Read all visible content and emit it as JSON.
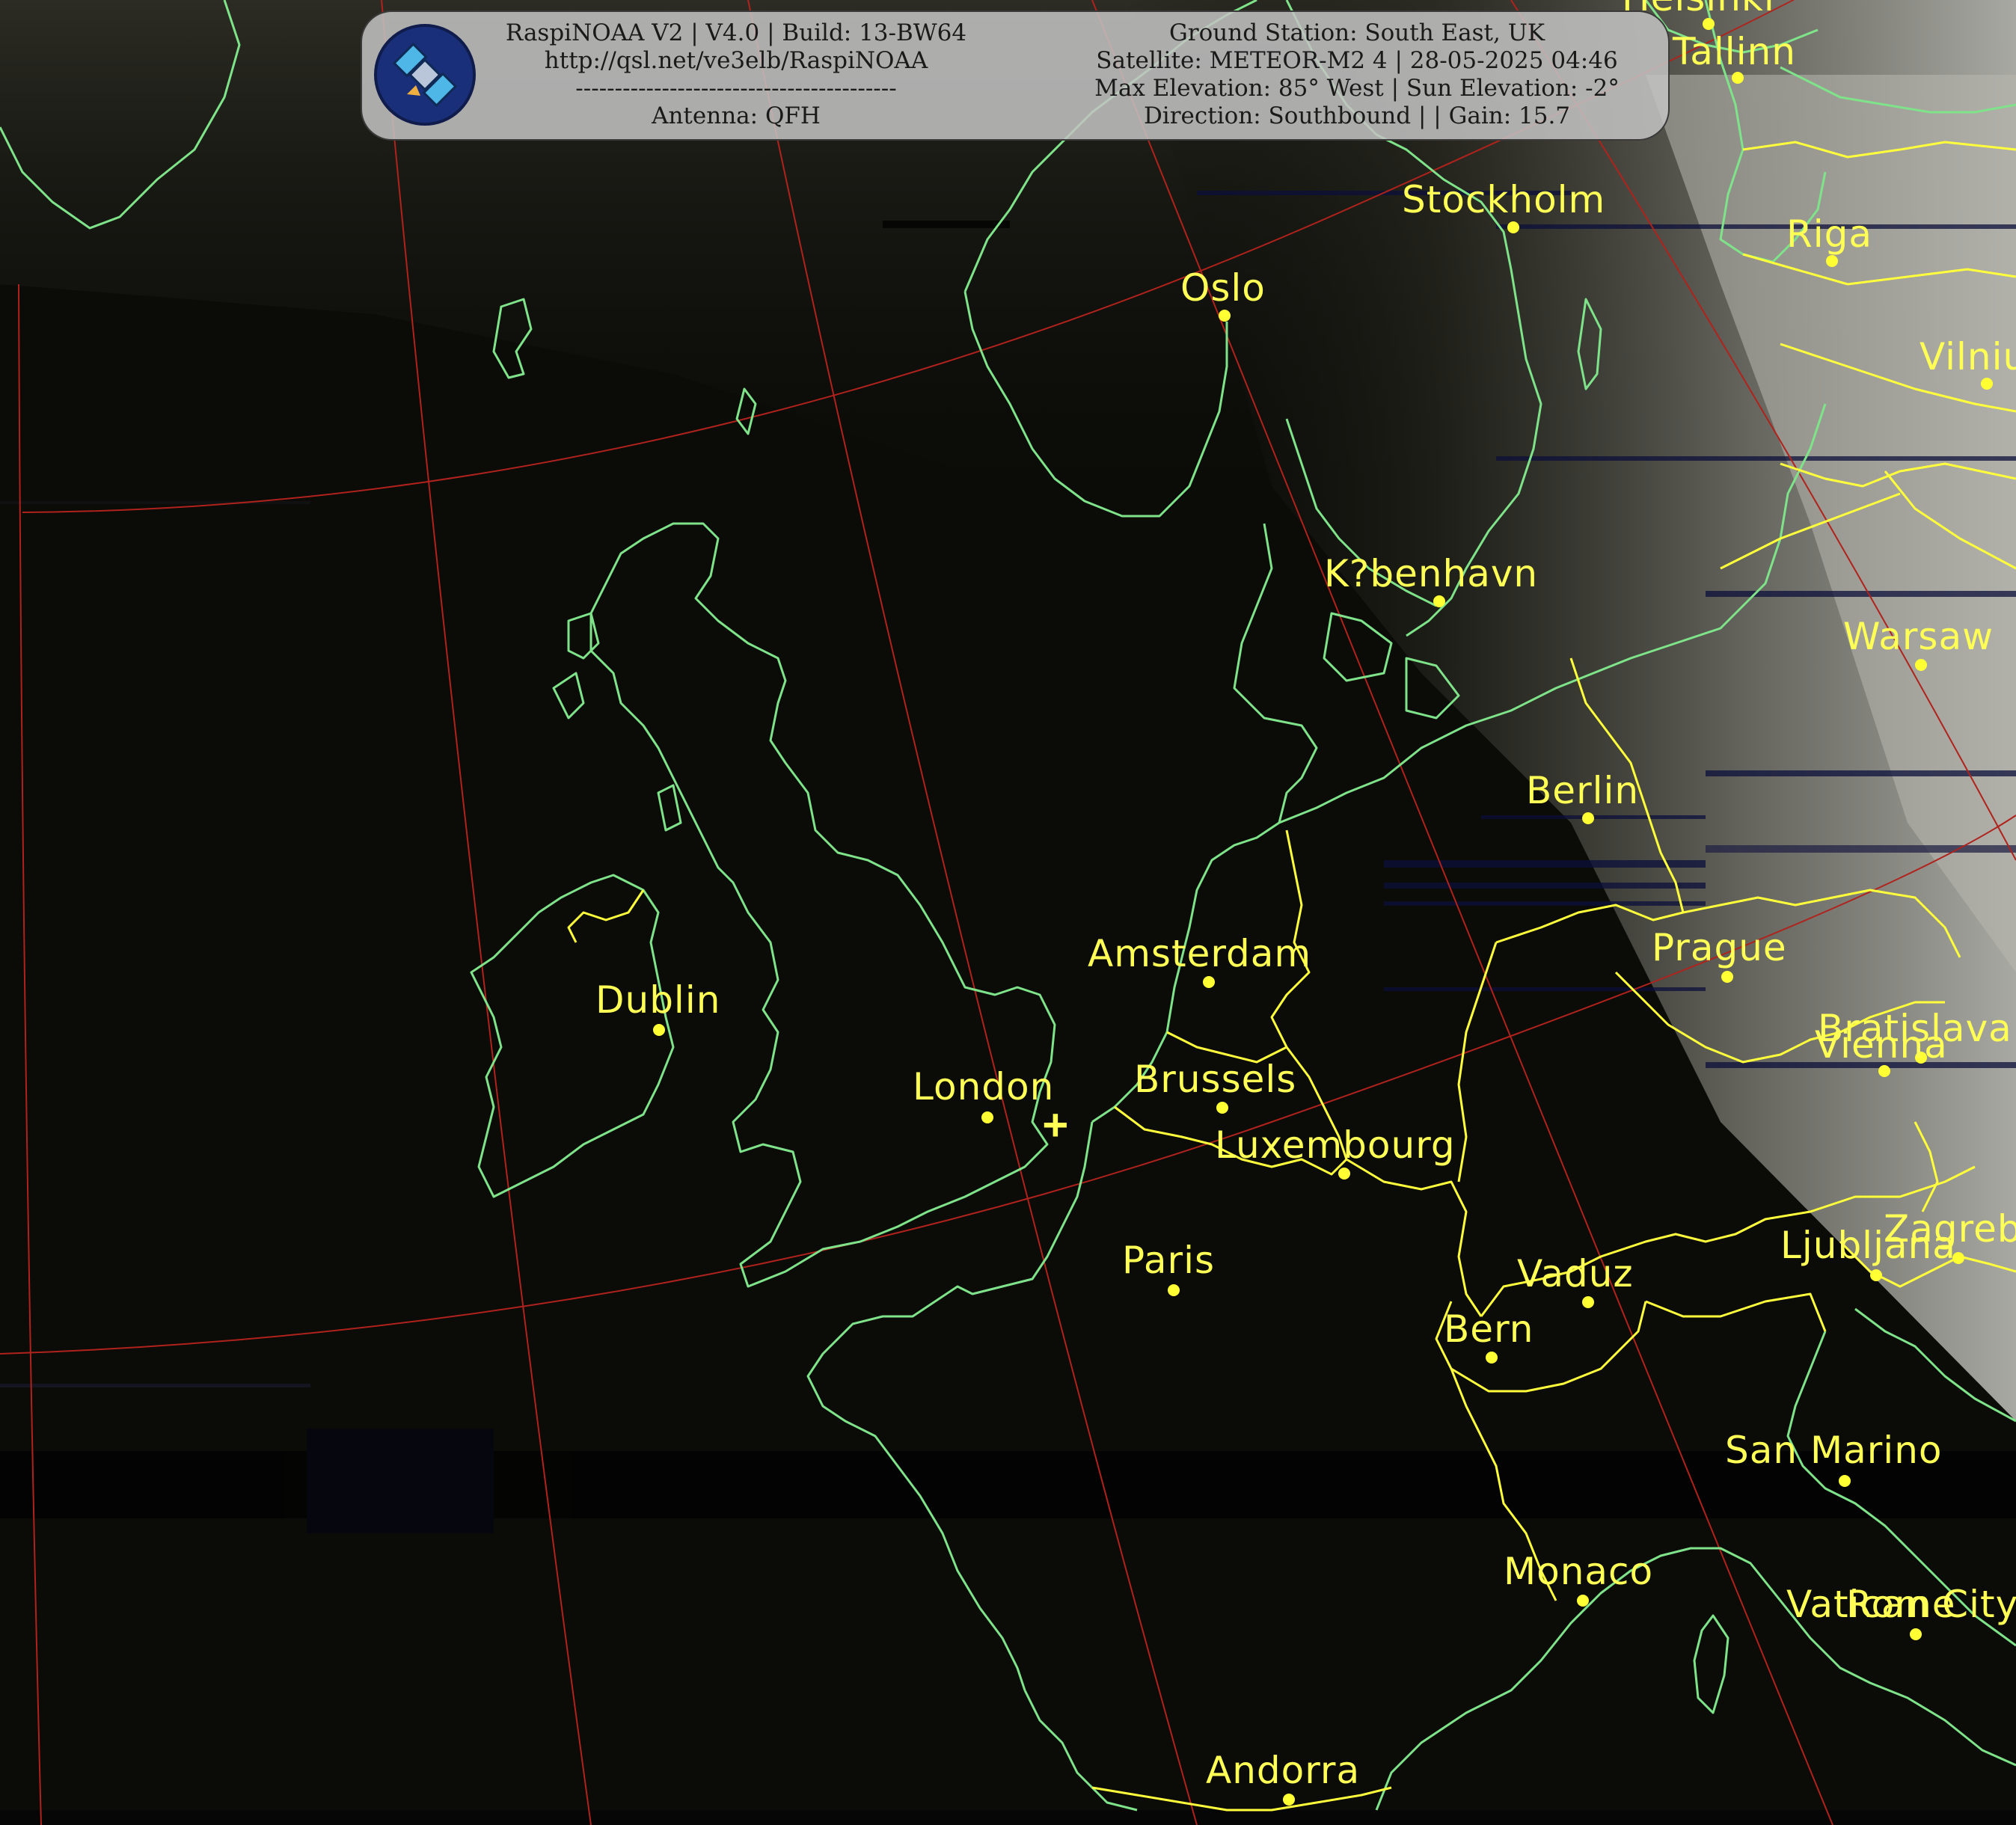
{
  "header": {
    "left": {
      "line1": "RaspiNOAA V2 | V4.0 | Build: 13-BW64",
      "line2": "http://qsl.net/ve3elb/RaspiNOAA",
      "line3": "-----------------------------------------",
      "line4": "Antenna: QFH"
    },
    "right": {
      "line1": "Ground Station: South East, UK",
      "line2": "Satellite: METEOR-M2 4 | 28-05-2025 04:46",
      "line3": "Max Elevation: 85° West | Sun Elevation: -2°",
      "line4": "Direction: Southbound | | Gain: 15.7"
    },
    "logo_icon": "satellite-icon"
  },
  "colors": {
    "coastline": "#7fe38a",
    "border": "#ffff3c",
    "graticule": "#b0221c",
    "label": "#ffff55",
    "panel": "#c4c4c4"
  },
  "cities": [
    {
      "name": "Helsinki",
      "label": "Helsinki"
    },
    {
      "name": "Tallinn",
      "label": "Tallinn"
    },
    {
      "name": "Stockholm",
      "label": "Stockholm"
    },
    {
      "name": "Riga",
      "label": "Riga"
    },
    {
      "name": "Oslo",
      "label": "Oslo"
    },
    {
      "name": "Vilnius",
      "label": "Vilnius"
    },
    {
      "name": "Copenhagen",
      "label": "K?benhavn"
    },
    {
      "name": "Warsaw",
      "label": "Warsaw"
    },
    {
      "name": "Berlin",
      "label": "Berlin"
    },
    {
      "name": "Amsterdam",
      "label": "Amsterdam"
    },
    {
      "name": "Prague",
      "label": "Prague"
    },
    {
      "name": "Dublin",
      "label": "Dublin"
    },
    {
      "name": "Bratislava",
      "label": "Bratislava"
    },
    {
      "name": "Vienna",
      "label": "Vienna"
    },
    {
      "name": "London",
      "label": "London"
    },
    {
      "name": "Brussels",
      "label": "Brussels"
    },
    {
      "name": "Luxembourg",
      "label": "Luxembourg"
    },
    {
      "name": "Zagreb",
      "label": "Zagreb"
    },
    {
      "name": "Paris",
      "label": "Paris"
    },
    {
      "name": "Ljubljana",
      "label": "Ljubljana"
    },
    {
      "name": "Vaduz",
      "label": "Vaduz"
    },
    {
      "name": "Bern",
      "label": "Bern"
    },
    {
      "name": "San Marino",
      "label": "San Marino"
    },
    {
      "name": "Monaco",
      "label": "Monaco"
    },
    {
      "name": "Vatican City",
      "label": "Vatican City"
    },
    {
      "name": "Rome",
      "label": "Rome"
    },
    {
      "name": "Andorra",
      "label": "Andorra"
    }
  ],
  "ground_station": {
    "name": "South East, UK",
    "icon": "plus-marker-icon"
  }
}
